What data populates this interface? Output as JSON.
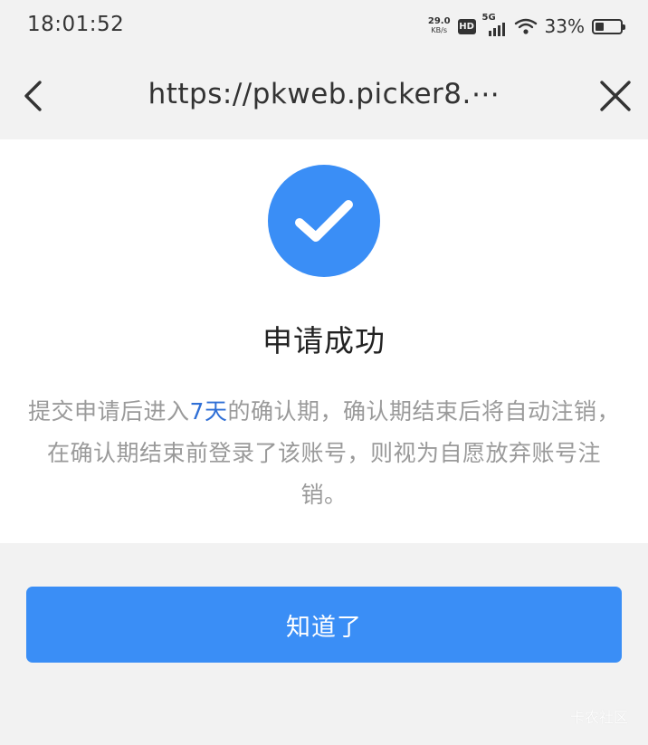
{
  "status_bar": {
    "time": "18:01:52",
    "net_speed_value": "29.0",
    "net_speed_unit": "KB/s",
    "hd_label": "HD",
    "network_label": "5G",
    "battery_percent_text": "33%",
    "battery_level": 0.33
  },
  "nav": {
    "url": "https://pkweb.picker8.⋯",
    "back_icon": "chevron-left-icon",
    "close_icon": "close-icon"
  },
  "result": {
    "icon": "check-circle-icon",
    "title": "申请成功",
    "desc_before": "提交申请后进入",
    "desc_highlight": "7天",
    "desc_after": "的确认期，确认期结束后将自动注销，在确认期结束前登录了该账号，则视为自愿放弃账号注销。"
  },
  "action": {
    "confirm_label": "知道了"
  },
  "watermark": "卡农社区",
  "colors": {
    "accent": "#3a8ef6",
    "highlight": "#2f6fd6",
    "page_bg": "#f2f2f2",
    "card_bg": "#ffffff",
    "text_muted": "#9a9a9a"
  }
}
